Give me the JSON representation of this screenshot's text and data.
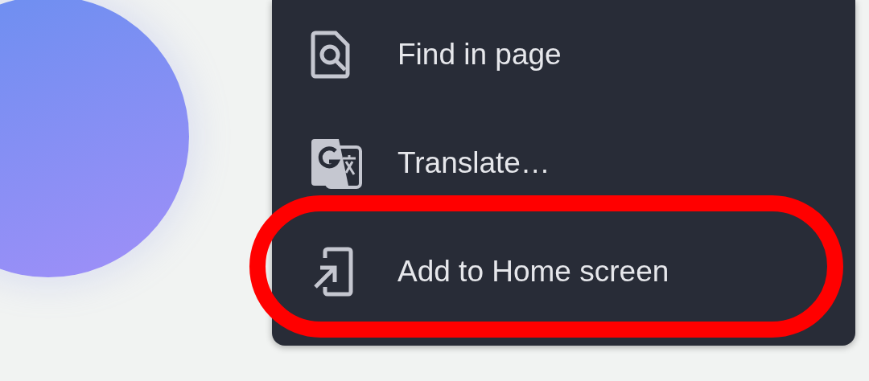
{
  "menu": {
    "items": [
      {
        "kind": "find",
        "label": "Find in page",
        "highlighted": false
      },
      {
        "kind": "translate",
        "label": "Translate…",
        "highlighted": false
      },
      {
        "kind": "add-home",
        "label": "Add to Home screen",
        "highlighted": true
      }
    ]
  }
}
